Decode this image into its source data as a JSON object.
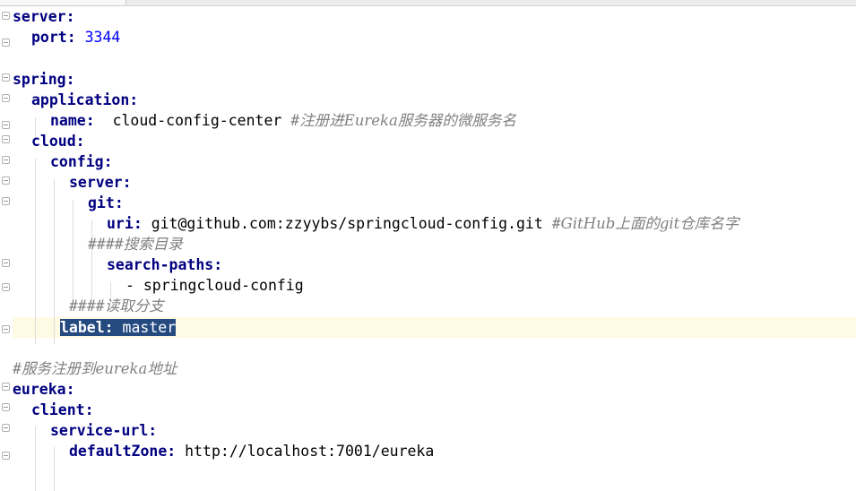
{
  "editor": {
    "lines": [
      {
        "key": "server",
        "punct": ":"
      },
      {
        "key": "port",
        "punct": ": ",
        "value": "3344"
      },
      {},
      {
        "key": "spring",
        "punct": ":"
      },
      {
        "key": "application",
        "punct": ":"
      },
      {
        "key": "name",
        "punct": ":  ",
        "value": "cloud-config-center",
        "comment_mark": " #",
        "comment_text": "注册进Eureka服务器的微服务名"
      },
      {
        "key": "cloud",
        "punct": ":"
      },
      {
        "key": "config",
        "punct": ":"
      },
      {
        "key": "server",
        "punct": ":"
      },
      {
        "key": "git",
        "punct": ":"
      },
      {
        "key": "uri",
        "punct": ": ",
        "value": "git@github.com:zzyybs/springcloud-config.git",
        "comment_mark": " #",
        "comment_text": "GitHub上面的git仓库名字"
      },
      {
        "comment_mark": "####",
        "comment_text": "搜索目录"
      },
      {
        "key": "search-paths",
        "punct": ":"
      },
      {
        "value": "- springcloud-config"
      },
      {
        "comment_mark": "####",
        "comment_text": "读取分支"
      },
      {
        "key": "label",
        "punct": ": ",
        "value": "master"
      },
      {},
      {
        "comment_mark": "#",
        "comment_text": "服务注册到eureka地址"
      },
      {
        "key": "eureka",
        "punct": ":"
      },
      {
        "key": "client",
        "punct": ":"
      },
      {
        "key": "service-url",
        "punct": ":"
      },
      {
        "key": "defaultZone",
        "punct": ": ",
        "value": "http://localhost:7001/eureka"
      }
    ]
  },
  "colors": {
    "key": "#000080",
    "number": "#0000ff",
    "comment": "#808080",
    "current_line": "#fffae3",
    "selection": "#244a80"
  }
}
